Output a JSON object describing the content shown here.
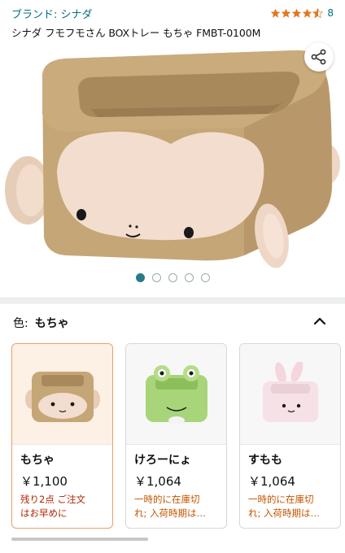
{
  "header": {
    "brand": "ブランド: シナダ",
    "rating_count": "8",
    "title": "シナダ フモフモさん BOXトレー もちゃ FMBT-0100M"
  },
  "gallery": {
    "image_count": 5,
    "active_index": 0
  },
  "color_selector": {
    "label": "色:",
    "value": "もちゃ"
  },
  "variants": [
    {
      "name": "もちゃ",
      "price": "￥1,100",
      "avail_line1": "残り2点 ご注文",
      "avail_line2": "はお早めに",
      "avail_color": "#b12704",
      "thumb": "monkey"
    },
    {
      "name": "けろーにょ",
      "price": "￥1,064",
      "avail_line1": "一時的に在庫切",
      "avail_line2": "れ; 入荷時期は…",
      "avail_color": "#c45500",
      "thumb": "frog"
    },
    {
      "name": "すもも",
      "price": "￥1,064",
      "avail_line1": "一時的に在庫切",
      "avail_line2": "れ; 入荷時期は…",
      "avail_color": "#c45500",
      "thumb": "rabbit"
    }
  ],
  "colors": {
    "link": "#007185",
    "star": "#de7921",
    "selected_border": "#e8a06a",
    "dot_active": "#2b7a8a"
  }
}
